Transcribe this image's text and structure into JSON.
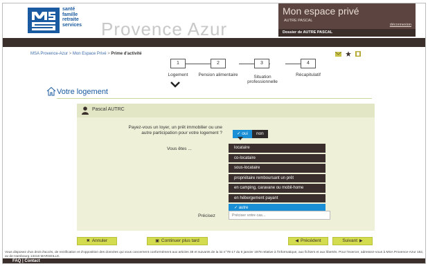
{
  "header": {
    "logo_lines": [
      "santé",
      "famille",
      "retraite",
      "services"
    ],
    "brand": "Provence Azur",
    "space_title": "Mon espace privé",
    "user_name": "AUTRE PASCAL",
    "logout": "déconnexion",
    "dossier": "Dossier de AUTRE PASCAL"
  },
  "breadcrumb": {
    "items": [
      "MSA Provence-Azur",
      "Mon Espace Privé"
    ],
    "separator": " > ",
    "current": "Prime d'activité"
  },
  "tools": {
    "icons": [
      "mail-icon",
      "star-icon",
      "print-icon"
    ]
  },
  "steps": [
    {
      "number": "1",
      "label": "Logement"
    },
    {
      "number": "2",
      "label": "Pension alimentaire"
    },
    {
      "number": "3",
      "label": "Situation professionnelle"
    },
    {
      "number": "4",
      "label": "Récapitulatif"
    }
  ],
  "section": {
    "title": "Votre logement"
  },
  "person": {
    "name": "Pascal AUTRC"
  },
  "question_loan": {
    "text": "Payez-vous un loyer, un prêt immobilier ou une autre participation pour votre logement ?",
    "yes": "✓ oui",
    "no": "non"
  },
  "question_status": {
    "label": "Vous êtes ...",
    "options": [
      "locataire",
      "co-locataire",
      "sous-locataire",
      "propriétaire remboursant un prêt",
      "en camping, caravane ou mobil-home",
      "en hébergement payant",
      "✓ autre"
    ],
    "selected_index": 6
  },
  "question_precise": {
    "label": "Précisez",
    "placeholder": "Préciser votre cas..."
  },
  "buttons": {
    "cancel": "Annuler",
    "later": "Continuer plus tard",
    "previous": "Précédent",
    "next": "Suivant"
  },
  "legal": "Vous disposez d'un droit d'accès, de rectification et d'opposition des données qui vous concernent conformément aux articles 38 et suivants de la loi n°78-17 du 6 janvier 1978 relative à l'informatique, aux fichiers et aux libertés. Pour l'exercer, adressez-vous à MSA Provence-Azur 152, av de Hambourg 13416 MARSEILLE.",
  "footer": {
    "faq": "FAQ",
    "separator": " | ",
    "contact": "Contact"
  },
  "colors": {
    "brand_blue": "#1a5aa0",
    "dark_brown": "#3b2f2c",
    "accent_blue": "#1a8fd5",
    "button_yellow": "#d3dc4e"
  }
}
